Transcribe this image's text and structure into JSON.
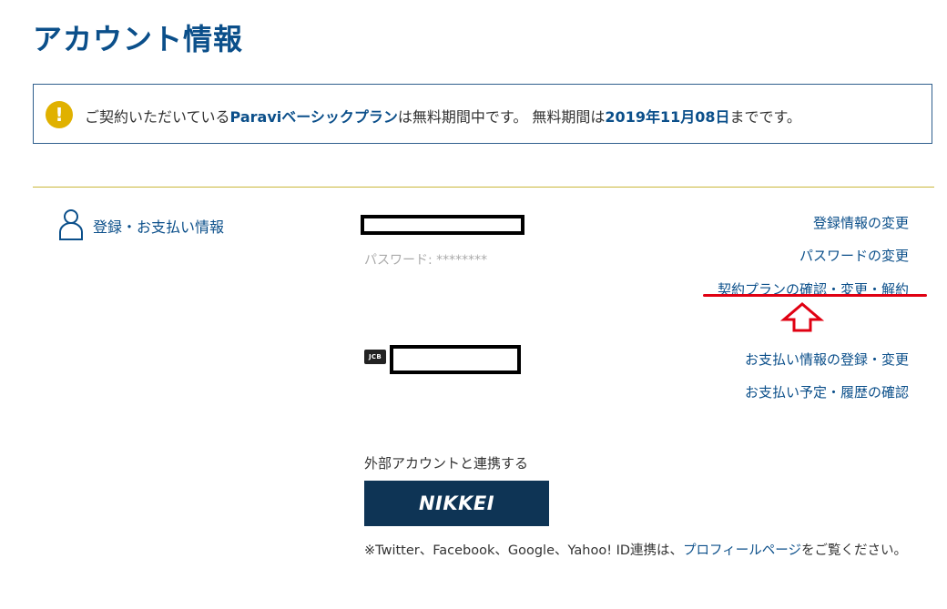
{
  "page": {
    "title": "アカウント情報"
  },
  "notice": {
    "icon": "!",
    "part1": "ご契約いただいている",
    "plan_name": "Paraviベーシックプラン",
    "part2": "は無料期間中です。 無料期間は",
    "end_date": "2019年11月08日",
    "part3": "までです。"
  },
  "section": {
    "title": "登録・お支払い情報",
    "password_label": "パスワード: ********",
    "card_brand": "JCB"
  },
  "links": {
    "edit_registration": "登録情報の変更",
    "change_password": "パスワードの変更",
    "plan_manage": "契約プランの確認・変更・解約",
    "payment_info": "お支払い情報の登録・変更",
    "payment_history": "お支払い予定・履歴の確認"
  },
  "external": {
    "label": "外部アカウントと連携する",
    "nikkei_label": "NIKKEI",
    "note_before": "※Twitter、Facebook、Google、Yahoo! ID連携は、",
    "note_link": "プロフィールページ",
    "note_after": "をご覧ください。"
  },
  "colors": {
    "primary": "#0b4f8a",
    "notice_icon": "#e0b100",
    "divider": "#c9b73a",
    "nikkei_bg": "#0e3455",
    "annotation_red": "#e00012"
  }
}
